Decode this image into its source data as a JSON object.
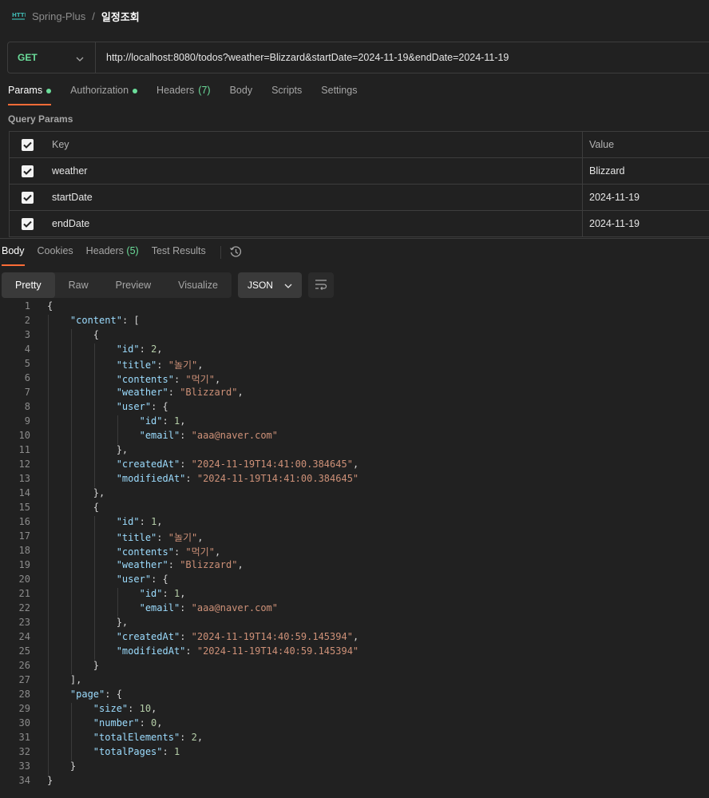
{
  "breadcrumb": {
    "icon": "http-icon",
    "parent": "Spring-Plus",
    "separator": "/",
    "current": "일정조회"
  },
  "request": {
    "method": "GET",
    "url": "http://localhost:8080/todos?weather=Blizzard&startDate=2024-11-19&endDate=2024-11-19"
  },
  "request_tabs": [
    {
      "label": "Params",
      "dot": true,
      "active": true
    },
    {
      "label": "Authorization",
      "dot": true
    },
    {
      "label": "Headers",
      "count": "(7)"
    },
    {
      "label": "Body"
    },
    {
      "label": "Scripts"
    },
    {
      "label": "Settings"
    }
  ],
  "query_params": {
    "title": "Query Params",
    "header": {
      "key": "Key",
      "value": "Value"
    },
    "rows": [
      {
        "key": "weather",
        "value": "Blizzard",
        "checked": true
      },
      {
        "key": "startDate",
        "value": "2024-11-19",
        "checked": true
      },
      {
        "key": "endDate",
        "value": "2024-11-19",
        "checked": true
      }
    ]
  },
  "response_tabs": [
    {
      "label": "Body",
      "active": true
    },
    {
      "label": "Cookies"
    },
    {
      "label": "Headers",
      "count": "(5)"
    },
    {
      "label": "Test Results"
    }
  ],
  "view_modes": [
    "Pretty",
    "Raw",
    "Preview",
    "Visualize"
  ],
  "active_view": "Pretty",
  "format": "JSON",
  "code_lines": [
    "{",
    "    \"content\": [",
    "        {",
    "            \"id\": 2,",
    "            \"title\": \"놀기\",",
    "            \"contents\": \"먹기\",",
    "            \"weather\": \"Blizzard\",",
    "            \"user\": {",
    "                \"id\": 1,",
    "                \"email\": \"aaa@naver.com\"",
    "            },",
    "            \"createdAt\": \"2024-11-19T14:41:00.384645\",",
    "            \"modifiedAt\": \"2024-11-19T14:41:00.384645\"",
    "        },",
    "        {",
    "            \"id\": 1,",
    "            \"title\": \"놀기\",",
    "            \"contents\": \"먹기\",",
    "            \"weather\": \"Blizzard\",",
    "            \"user\": {",
    "                \"id\": 1,",
    "                \"email\": \"aaa@naver.com\"",
    "            },",
    "            \"createdAt\": \"2024-11-19T14:40:59.145394\",",
    "            \"modifiedAt\": \"2024-11-19T14:40:59.145394\"",
    "        }",
    "    ],",
    "    \"page\": {",
    "        \"size\": 10,",
    "        \"number\": 0,",
    "        \"totalElements\": 2,",
    "        \"totalPages\": 1",
    "    }",
    "}"
  ],
  "colors": {
    "accent": "#ff6c37",
    "method": "#6bdd9a",
    "key": "#9cdcfe",
    "string": "#ce9178",
    "number": "#b5cea8"
  }
}
